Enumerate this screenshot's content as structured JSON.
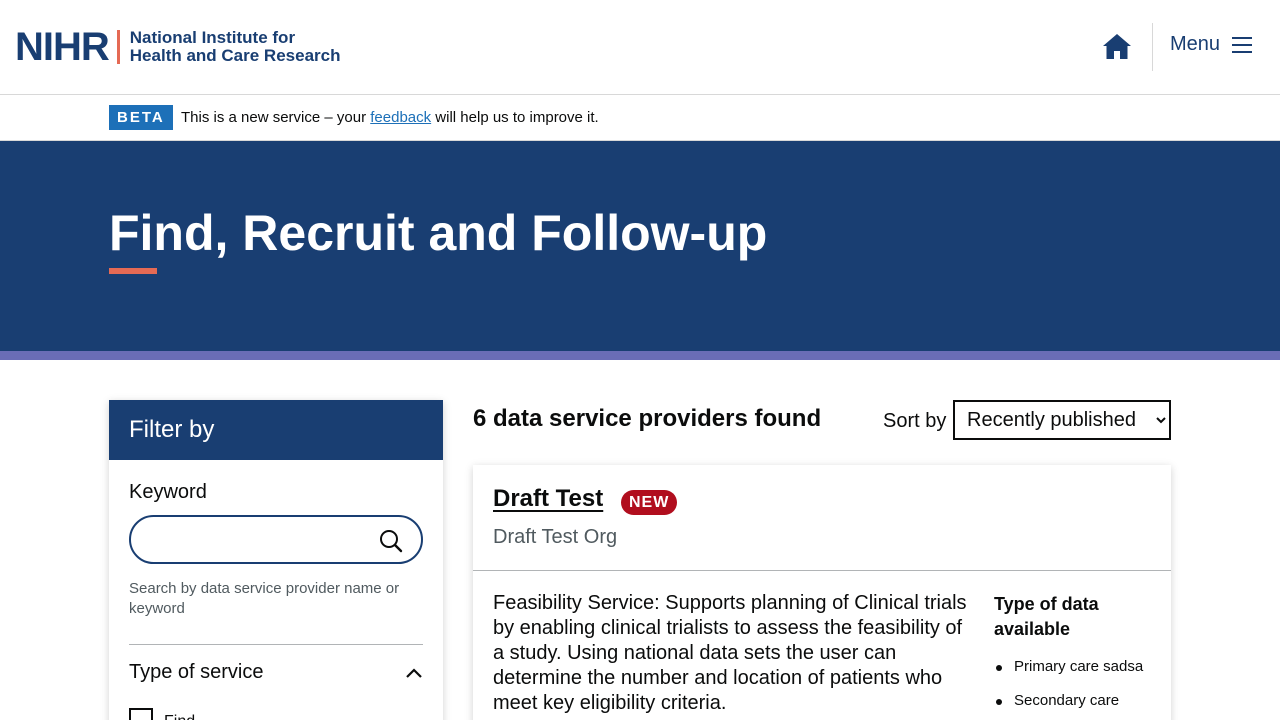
{
  "header": {
    "logo_mark": "NIHR",
    "logo_line1": "National Institute for",
    "logo_line2": "Health and Care Research",
    "menu_label": "Menu"
  },
  "beta": {
    "tag": "BETA",
    "text_before": "This is a new service – your ",
    "link": "feedback",
    "text_after": " will help us to improve it."
  },
  "hero": {
    "title": "Find, Recruit and Follow-up"
  },
  "filter": {
    "heading": "Filter by",
    "keyword_label": "Keyword",
    "keyword_value": "",
    "keyword_hint": "Search by data service provider name or keyword",
    "type_of_service_label": "Type of service",
    "options": [
      {
        "label": "Find",
        "checked": false
      }
    ]
  },
  "results": {
    "count_text": "6 data service providers found",
    "sort_label": "Sort by",
    "sort_selected": "Recently published"
  },
  "cards": [
    {
      "title": "Draft Test",
      "badge": "NEW",
      "org": "Draft Test Org",
      "description": "Feasibility Service: Supports planning of Clinical trials by enabling clinical trialists to assess the feasibility of a study. Using national data sets the user can determine the number and location of patients who meet key eligibility criteria.",
      "data_heading": "Type of data available",
      "data_types": [
        "Primary care sadsa",
        "Secondary care"
      ]
    }
  ],
  "colors": {
    "brand_navy": "#193e72",
    "accent_coral": "#e56a54",
    "strip_purple": "#6a6db6",
    "beta_blue": "#1d70b8",
    "badge_red": "#b10e1e"
  },
  "icons": [
    "home-icon",
    "menu-icon",
    "search-icon",
    "chevron-up-icon",
    "checkbox"
  ]
}
